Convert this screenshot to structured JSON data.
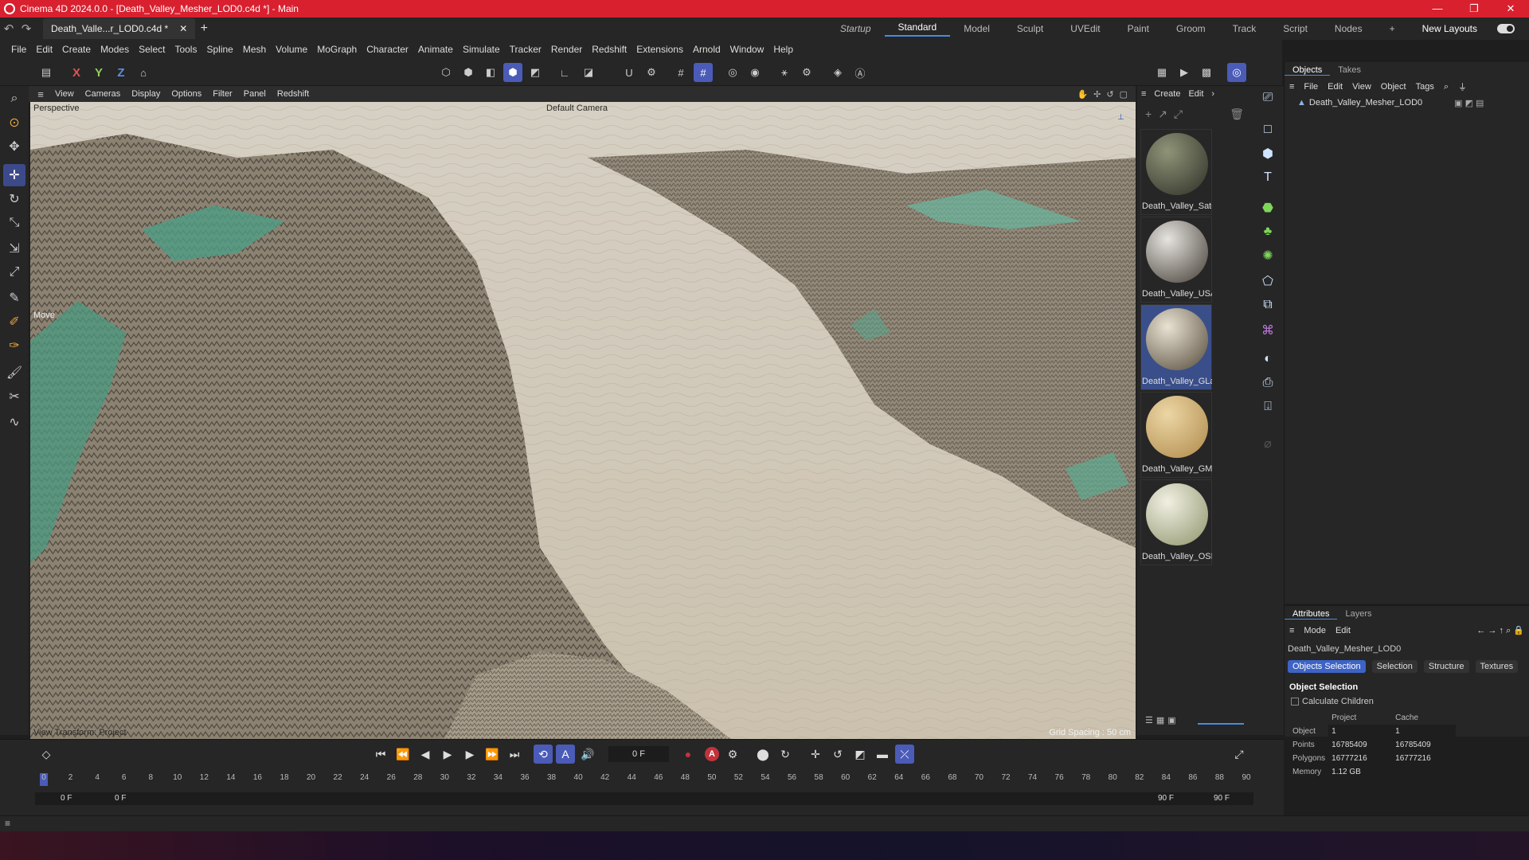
{
  "window": {
    "title": "Cinema 4D 2024.0.0 - [Death_Valley_Mesher_LOD0.c4d *] - Main",
    "controls": [
      "—",
      "❐",
      "✕"
    ]
  },
  "doc_tab": {
    "label": "Death_Valle...r_LOD0.c4d *",
    "close": "✕"
  },
  "layouts": {
    "items": [
      "Startup",
      "Standard",
      "Model",
      "Sculpt",
      "UVEdit",
      "Paint",
      "Groom",
      "Track",
      "Script",
      "Nodes"
    ],
    "active": "Standard",
    "new_layouts": "New Layouts"
  },
  "menubar": [
    "File",
    "Edit",
    "Create",
    "Modes",
    "Select",
    "Tools",
    "Spline",
    "Mesh",
    "Volume",
    "MoGraph",
    "Character",
    "Animate",
    "Simulate",
    "Tracker",
    "Render",
    "Redshift",
    "Extensions",
    "Arnold",
    "Window",
    "Help"
  ],
  "axis_toggles": [
    "X",
    "Y",
    "Z"
  ],
  "viewport": {
    "menu": [
      "View",
      "Cameras",
      "Display",
      "Options",
      "Filter",
      "Panel",
      "Redshift"
    ],
    "projection": "Perspective",
    "camera": "Default Camera",
    "move_label": "Move",
    "view_transform": "View Transform: Project",
    "grid_spacing": "Grid Spacing : 50 cm"
  },
  "materials": {
    "menu": [
      "Create",
      "Edit"
    ],
    "items": [
      {
        "label": "Death_Valley_Sate",
        "color1": "#8f9478",
        "color2": "#3c3e32"
      },
      {
        "label": "Death_Valley_USA",
        "color1": "#e6e4df",
        "color2": "#5b564e"
      },
      {
        "label": "Death_Valley_GLa",
        "color1": "#e9e2d3",
        "color2": "#6a6050"
      },
      {
        "label": "Death_Valley_GMa",
        "color1": "#ecd6a4",
        "color2": "#b89558"
      },
      {
        "label": "Death_Valley_OSN",
        "color1": "#f1efe3",
        "color2": "#9ca27c"
      }
    ],
    "selected_index": 2
  },
  "objects_panel": {
    "tabs": [
      "Objects",
      "Takes"
    ],
    "menu": [
      "File",
      "Edit",
      "View",
      "Object",
      "Tags"
    ],
    "items": [
      {
        "name": "Death_Valley_Mesher_LOD0"
      }
    ]
  },
  "attributes": {
    "tabs": [
      "Attributes",
      "Layers"
    ],
    "menu": [
      "Mode",
      "Edit"
    ],
    "object_name": "Death_Valley_Mesher_LOD0",
    "buttons": [
      "Objects Selection",
      "Selection",
      "Structure",
      "Textures"
    ],
    "active_button": "Objects Selection",
    "section_title": "Object Selection",
    "calc_children": "Calculate Children",
    "columns": [
      "Project",
      "Cache"
    ],
    "rows": [
      {
        "label": "Object",
        "project": "1",
        "cache": "1"
      },
      {
        "label": "Points",
        "project": "16785409",
        "cache": "16785409"
      },
      {
        "label": "Polygons",
        "project": "16777216",
        "cache": "16777216"
      },
      {
        "label": "Memory",
        "project": "1.12 GB",
        "cache": ""
      }
    ]
  },
  "timeline": {
    "current_frame": "0 F",
    "ruler": [
      "0",
      "2",
      "4",
      "6",
      "8",
      "10",
      "12",
      "14",
      "16",
      "18",
      "20",
      "22",
      "24",
      "26",
      "28",
      "30",
      "32",
      "34",
      "36",
      "38",
      "40",
      "42",
      "44",
      "46",
      "48",
      "50",
      "52",
      "54",
      "56",
      "58",
      "60",
      "62",
      "64",
      "66",
      "68",
      "70",
      "72",
      "74",
      "76",
      "78",
      "80",
      "82",
      "84",
      "86",
      "88",
      "90"
    ],
    "range_start": "0 F",
    "range_start2": "0 F",
    "range_end": "90 F",
    "range_end2": "90 F"
  }
}
